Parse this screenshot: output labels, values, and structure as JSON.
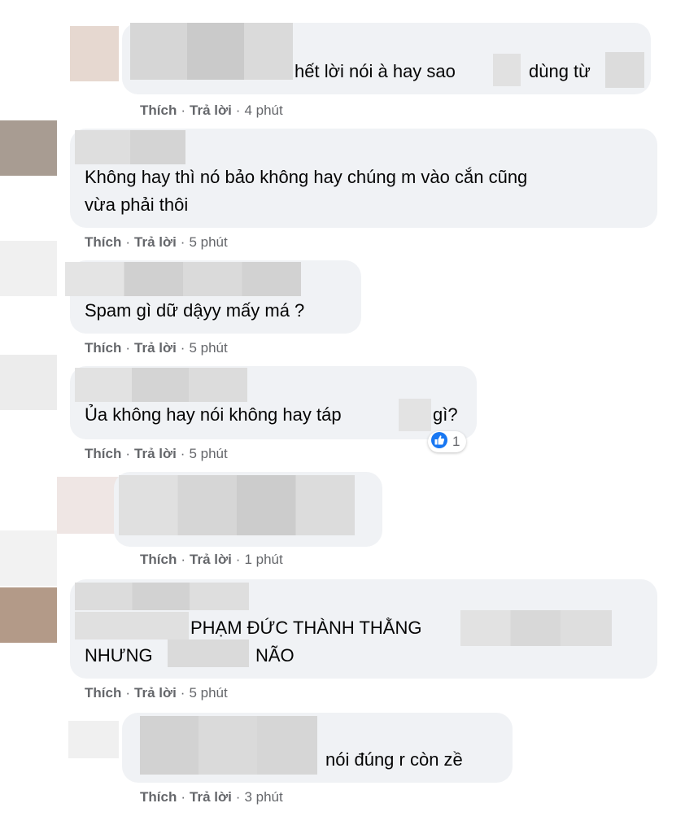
{
  "comments": [
    {
      "text_line1": "hết lời nói à hay sao",
      "text_tail": "dùng từ",
      "actions": {
        "like": "Thích",
        "reply": "Trả lời",
        "time": "4 phút"
      }
    },
    {
      "text_line1": "Không hay thì nó bảo không hay chúng m vào cắn cũng",
      "text_line2": "vừa phải thôi",
      "actions": {
        "like": "Thích",
        "reply": "Trả lời",
        "time": "5 phút"
      }
    },
    {
      "text_line1": "Spam gì dữ dậyy mấy má ?",
      "actions": {
        "like": "Thích",
        "reply": "Trả lời",
        "time": "5 phút"
      }
    },
    {
      "text_before": "Ủa không hay nói không hay táp",
      "text_after": "gì?",
      "reaction": {
        "icon": "like-icon",
        "count": "1",
        "color": "#1877f2"
      },
      "actions": {
        "like": "Thích",
        "reply": "Trả lời",
        "time": "5 phút"
      }
    },
    {
      "actions": {
        "like": "Thích",
        "reply": "Trả lời",
        "time": "1 phút"
      }
    },
    {
      "text_line1": "PHẠM ĐỨC THÀNH THẰNG",
      "text_line2a": "NHƯNG",
      "text_line2b": "NÃO",
      "actions": {
        "like": "Thích",
        "reply": "Trả lời",
        "time": "5 phút"
      }
    },
    {
      "text_line1": "nói đúng r còn zề",
      "actions": {
        "like": "Thích",
        "reply": "Trả lời",
        "time": "3 phút"
      }
    }
  ],
  "colors": {
    "bubble": "#f0f2f5",
    "meta": "#65676b",
    "text": "#050505",
    "like": "#1877f2"
  }
}
